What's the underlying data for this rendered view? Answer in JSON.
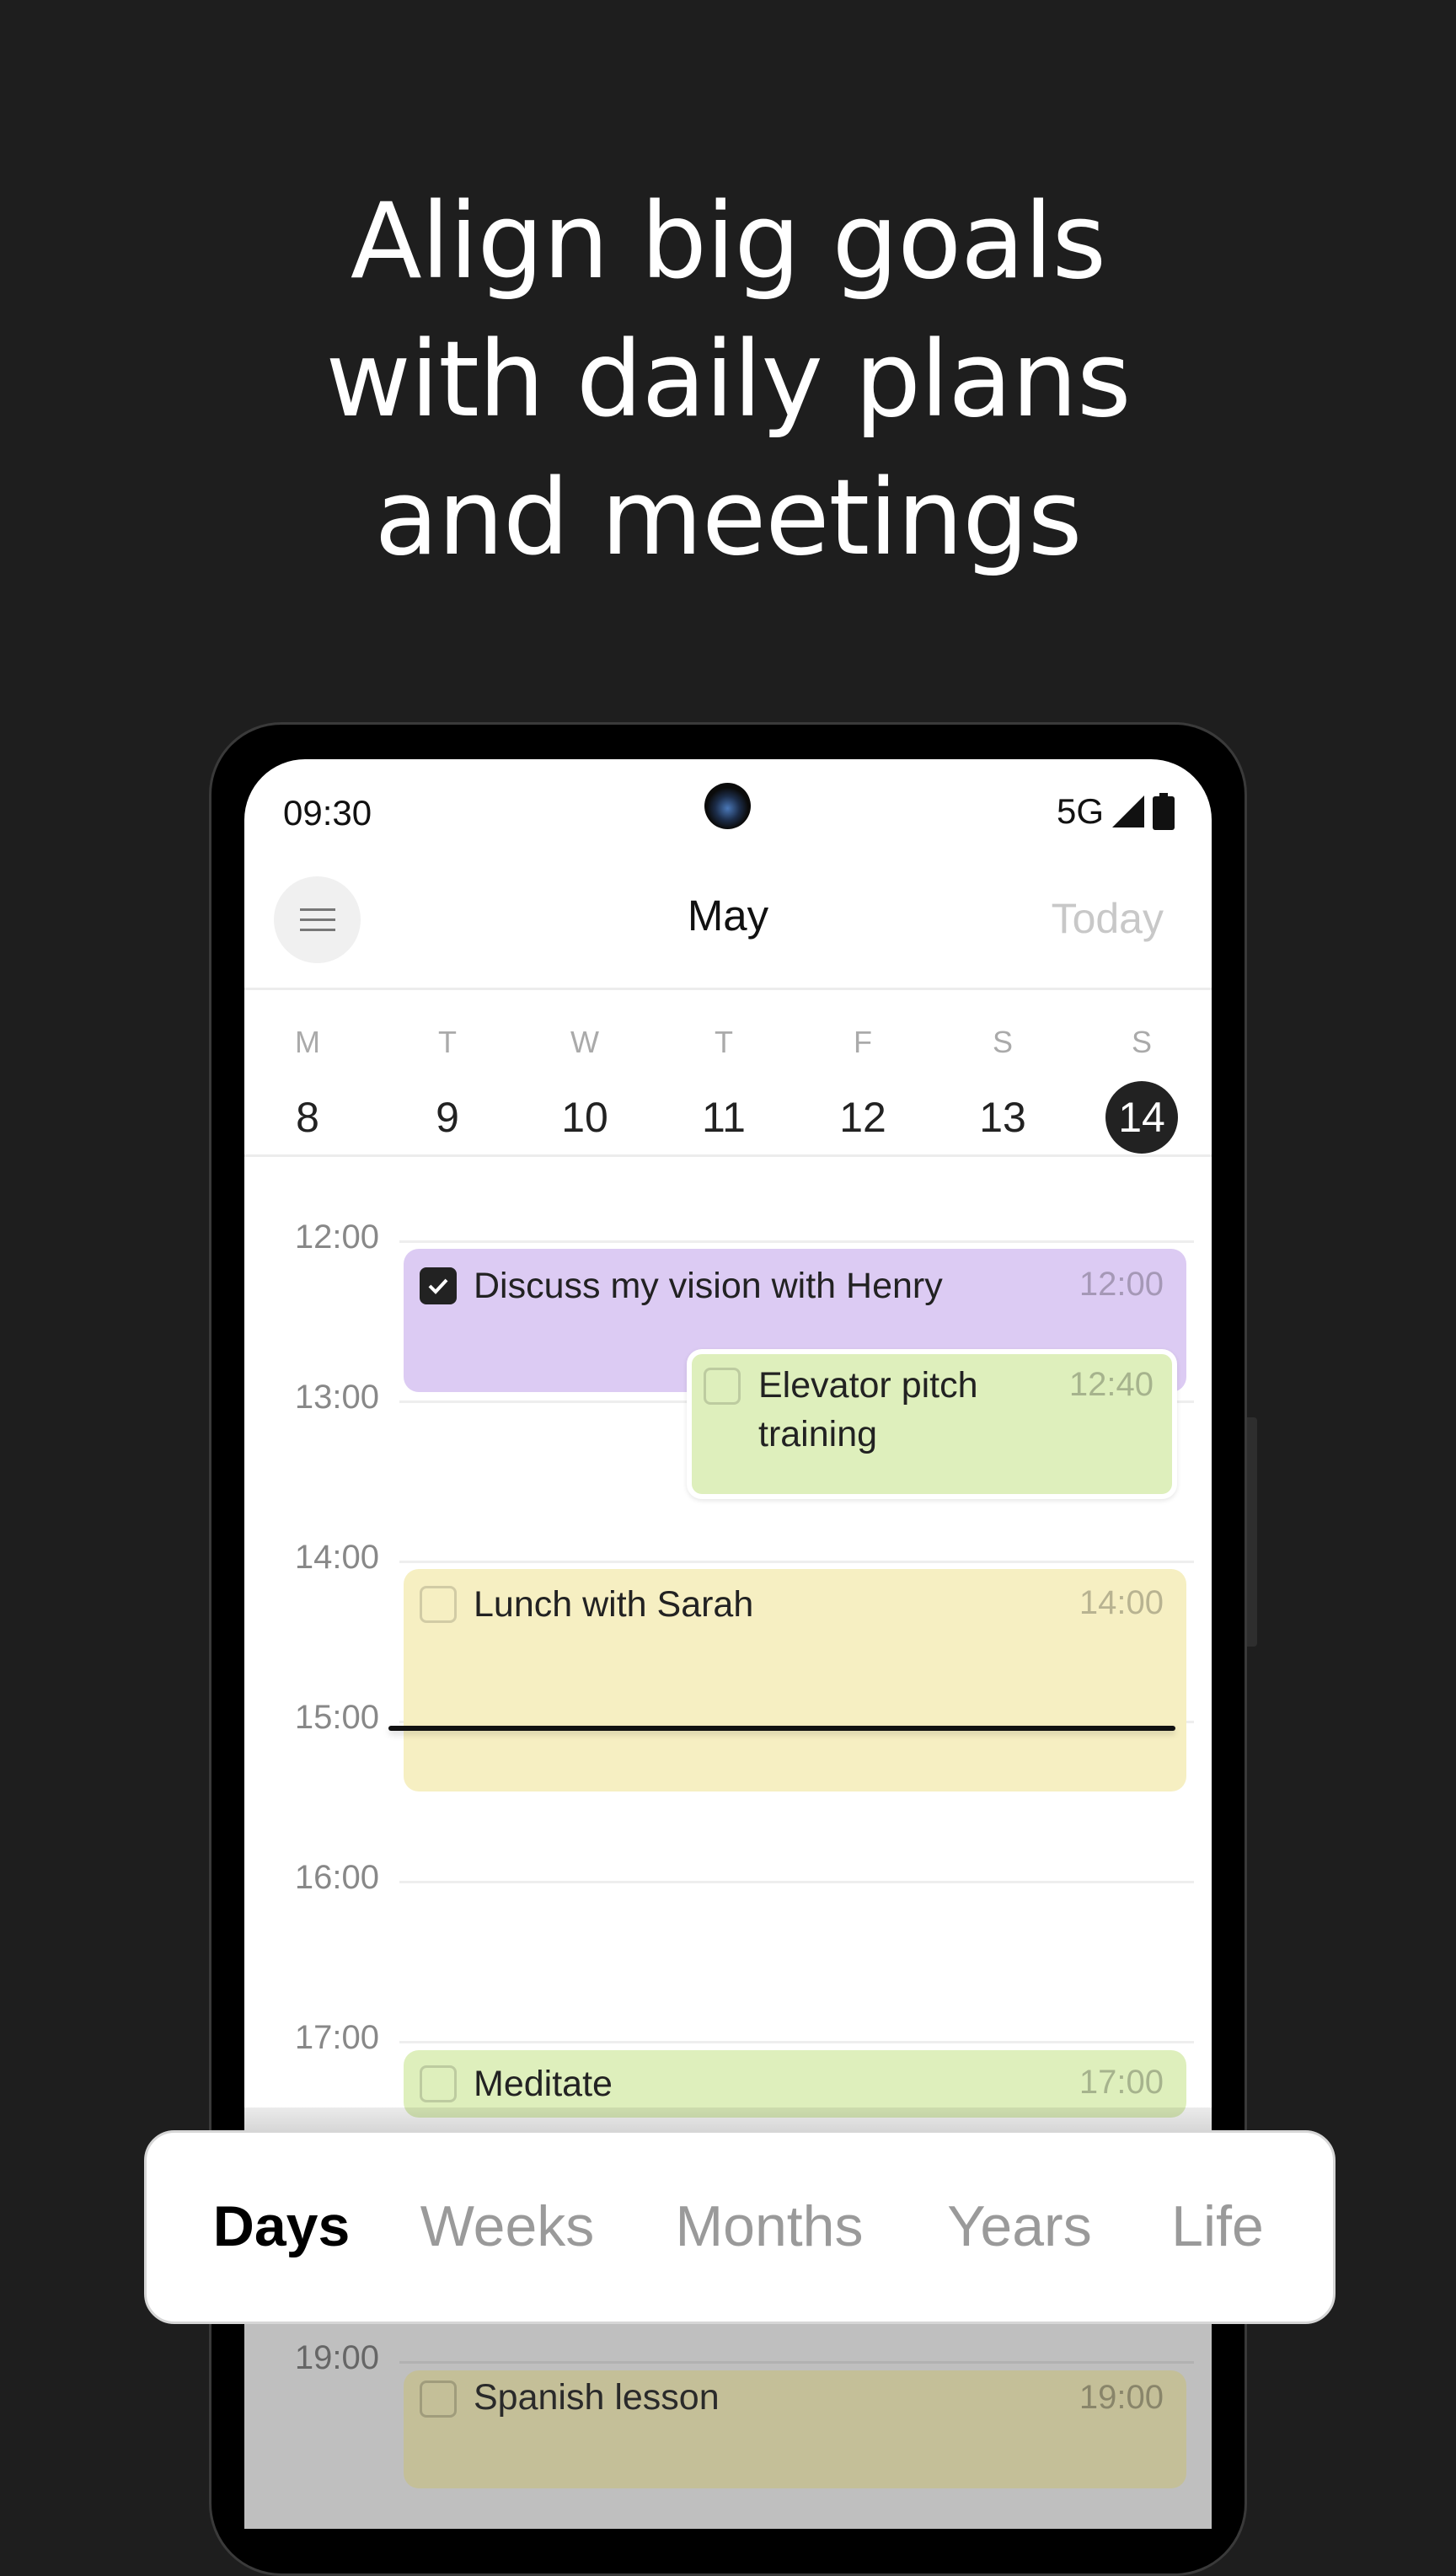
{
  "headline": {
    "line1": "Align big goals",
    "line2": "with daily plans",
    "line3": "and meetings"
  },
  "status_bar": {
    "time": "09:30",
    "network": "5G",
    "icons": [
      "signal-icon",
      "battery-icon"
    ]
  },
  "header": {
    "menu_icon": "hamburger-icon",
    "month": "May",
    "today_label": "Today"
  },
  "week": {
    "days": [
      {
        "letter": "M",
        "date": "8"
      },
      {
        "letter": "T",
        "date": "9"
      },
      {
        "letter": "W",
        "date": "10"
      },
      {
        "letter": "T",
        "date": "11"
      },
      {
        "letter": "F",
        "date": "12"
      },
      {
        "letter": "S",
        "date": "13"
      },
      {
        "letter": "S",
        "date": "14",
        "selected": true
      }
    ]
  },
  "hours": [
    "12:00",
    "13:00",
    "14:00",
    "15:00",
    "16:00",
    "17:00",
    "19:00"
  ],
  "events": [
    {
      "title": "Discuss my vision with Henry",
      "time": "12:00",
      "done": true,
      "color": "#dccbf3"
    },
    {
      "title": "Elevator pitch training",
      "time": "12:40",
      "done": false,
      "color": "#deefbc"
    },
    {
      "title": "Lunch with Sarah",
      "time": "14:00",
      "done": false,
      "color": "#f6efc2"
    },
    {
      "title": "Meditate",
      "time": "17:00",
      "done": false,
      "color": "#deefbc"
    },
    {
      "title": "Spanish lesson",
      "time": "19:00",
      "done": false,
      "color": "#f6efc2"
    }
  ],
  "view_tabs": [
    {
      "label": "Days",
      "active": true
    },
    {
      "label": "Weeks"
    },
    {
      "label": "Months"
    },
    {
      "label": "Years"
    },
    {
      "label": "Life"
    }
  ]
}
